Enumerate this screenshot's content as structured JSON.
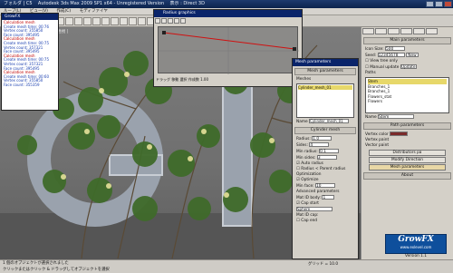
{
  "app": {
    "title": "Autodesk 3ds Max 2009 SP1 x64 - Unregistered Version",
    "title_prefix": "フォルダ | C5",
    "title_suffix": "表示 : Direct 3D"
  },
  "menubar": {
    "items": [
      "ループ(L)",
      "ビュー(V)",
      "作成(C)",
      "モディファイヤ"
    ]
  },
  "status_log": {
    "title": "GrowFX",
    "lines": [
      {
        "text": "Calculation mesh",
        "color": "red"
      },
      {
        "text": "Create mesh time: 00:76",
        "color": "blue"
      },
      {
        "text": "Vertex count: 355850",
        "color": "blue"
      },
      {
        "text": "Face count: 395495",
        "color": "blue"
      },
      {
        "text": "Calculation mesh",
        "color": "red"
      },
      {
        "text": "Create mesh time: 00:75",
        "color": "blue"
      },
      {
        "text": "Vertex count: 357321",
        "color": "blue"
      },
      {
        "text": "Face count: 395495",
        "color": "blue"
      },
      {
        "text": "Calculation mesh",
        "color": "red"
      },
      {
        "text": "Create mesh time: 00:75",
        "color": "blue"
      },
      {
        "text": "Vertex count: 357321",
        "color": "blue"
      },
      {
        "text": "Face count: 395495",
        "color": "blue"
      },
      {
        "text": "Calculation mesh",
        "color": "red"
      },
      {
        "text": "Create mesh time: 00:60",
        "color": "blue"
      },
      {
        "text": "Vertex count: 355850",
        "color": "blue"
      },
      {
        "text": "Face count: 355359",
        "color": "blue"
      }
    ]
  },
  "radius_window": {
    "title": "Radius graphics",
    "footer": "ドラッグ 移動 選択 作成数 1.00"
  },
  "mesh_window": {
    "title": "Mesh parameters",
    "rollout_mesh": "Mesh parameters",
    "meshes_label": "Meshes",
    "meshes_list": [
      "Cylinder_mesh_01"
    ],
    "name_label": "Name",
    "name_value": "Cylinder_mesh_01",
    "rollout_cylinder": "Cylinder mesh",
    "radius_label": "Radius:",
    "radius_value": "1.0",
    "sides_label": "Sides:",
    "sides_value": "4",
    "min_radius_label": "Min radius:",
    "min_radius_value": "0.1",
    "min_sides_label": "Min sides:",
    "min_sides_value": "3",
    "auto_radius": "Auto radius",
    "radius_parent": "Radius < Parent radius",
    "optimization_label": "Optimization",
    "optimize_label": "Optimize",
    "min_face_label": "Min face:",
    "min_face_value": "10",
    "advanced_label": "Advanced parameters",
    "mat_id_label": "Mat ID body:",
    "mat_id_value": "1",
    "cap_start": "Cap start",
    "sphere_option": "Sphere",
    "mat_id_cap_label": "Mat ID cap:",
    "cap_end": "Cap end"
  },
  "command_panel": {
    "main_params": "Main parameters",
    "icon_size_label": "Icon Size:",
    "icon_size_value": "500",
    "seed_label": "Seed:",
    "seed_value": "12345678",
    "new_button": "New",
    "view_tree_only": "View tree only",
    "manual_update": "Manual update",
    "update_button": "Update",
    "paths_label": "Paths",
    "paths": [
      "Stem",
      "Branches_1",
      "Branches_1",
      "Flowers_stat",
      "Flowers"
    ],
    "name_label": "Name",
    "name_value": "Stem",
    "path_params": "Path parameters",
    "vertex_color_label": "Vertex color",
    "vertex_paint_label": "Vertex paint",
    "vector_label": "Vector paint",
    "distributors_btn": "Distributors pa",
    "modify_direction_btn": "Modify Direction",
    "mesh_params_btn": "Mesh parameters",
    "about_label": "About",
    "version": "Version 1.1"
  },
  "growfx_logo": {
    "logo": "GrowFX",
    "url": "www.exlevel.com"
  },
  "viewport": {
    "label": "[ 透視 ]"
  },
  "statusbar": {
    "line1": "1 個のオブジェクトが選択されました",
    "line2": "クリックまたはクリック & ドラッグしてオブジェクトを選択",
    "grid": "グリッド = 10.0"
  },
  "colors": {
    "title_bg": "#0b234d",
    "accent": "#e7d86a",
    "growfx": "#0e4f9c"
  }
}
